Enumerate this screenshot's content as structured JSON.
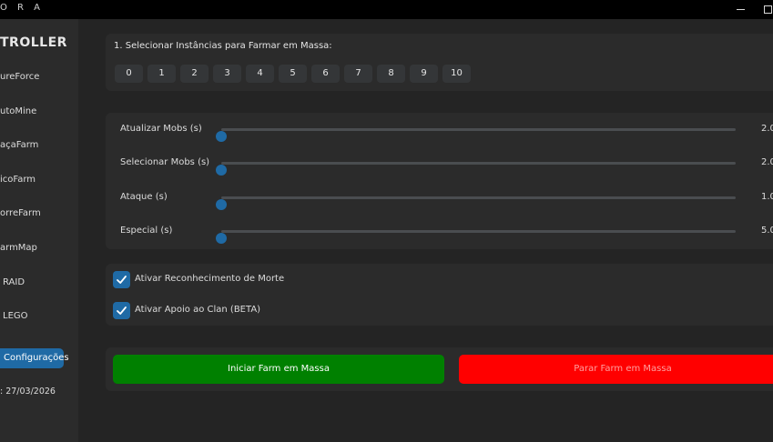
{
  "window": {
    "title": "O R A",
    "minimize_icon": "minimize-icon",
    "maximize_icon": "maximize-icon"
  },
  "sidebar": {
    "brand": "TROLLER",
    "items": [
      {
        "label": "ureForce"
      },
      {
        "label": "utoMine"
      },
      {
        "label": "açaFarm"
      },
      {
        "label": "icoFarm"
      },
      {
        "label": "orreFarm"
      },
      {
        "label": "armMap"
      },
      {
        "label": "RAID"
      },
      {
        "label": "LEGO"
      }
    ],
    "config_button": "Configurações",
    "date": ": 27/03/2026"
  },
  "instances": {
    "title": "1. Selecionar Instâncias para Farmar em Massa:",
    "buttons": [
      "0",
      "1",
      "2",
      "3",
      "4",
      "5",
      "6",
      "7",
      "8",
      "9",
      "10"
    ]
  },
  "sliders": [
    {
      "label": "Atualizar Mobs (s)",
      "value": "2.0",
      "fraction": 0.0
    },
    {
      "label": "Selecionar Mobs (s)",
      "value": "2.0",
      "fraction": 0.0
    },
    {
      "label": "Ataque (s)",
      "value": "1.0",
      "fraction": 0.0
    },
    {
      "label": "Especial (s)",
      "value": "5.0",
      "fraction": 0.0
    }
  ],
  "checks": [
    {
      "label": "Ativar Reconhecimento de Morte",
      "checked": true
    },
    {
      "label": "Ativar Apoio ao Clan (BETA)",
      "checked": true
    }
  ],
  "actions": {
    "start_label": "Iniciar Farm em Massa",
    "stop_label": "Parar Farm em Massa"
  },
  "colors": {
    "accent": "#1f6aa5",
    "start": "#008000",
    "stop": "#ff0000"
  }
}
